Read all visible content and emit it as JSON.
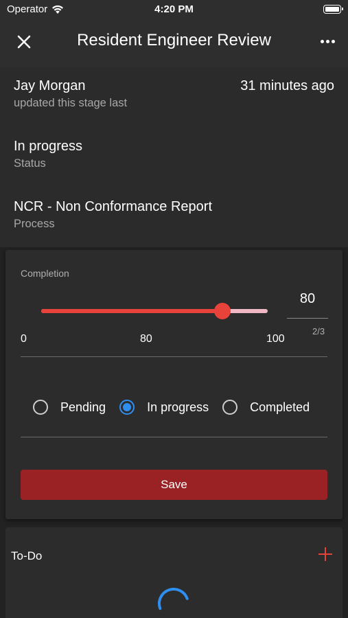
{
  "status_bar": {
    "carrier": "Operator",
    "time": "4:20 PM"
  },
  "nav": {
    "title": "Resident Engineer Review",
    "close_icon": "close-icon",
    "more_icon": "more-icon"
  },
  "info": {
    "updated_by": "Jay Morgan",
    "updated_sub": "updated this stage last",
    "updated_time": "31 minutes ago",
    "status_value": "In progress",
    "status_label": "Status",
    "process_value": "NCR - Non Conformance Report",
    "process_label": "Process"
  },
  "completion": {
    "label": "Completion",
    "value": 80,
    "min": 0,
    "max": 100,
    "tick_min": "0",
    "tick_mid": "80",
    "tick_max": "100",
    "input_value": "80",
    "char_count": "2/3",
    "options": [
      "Pending",
      "In progress",
      "Completed"
    ],
    "selected": "In progress",
    "save_label": "Save",
    "accent_color": "#e8433a",
    "radio_color": "#2f8ff0",
    "button_color": "#9a2224"
  },
  "todo": {
    "title": "To-Do",
    "add_icon": "plus-icon",
    "loading_icon": "spinner-icon"
  }
}
